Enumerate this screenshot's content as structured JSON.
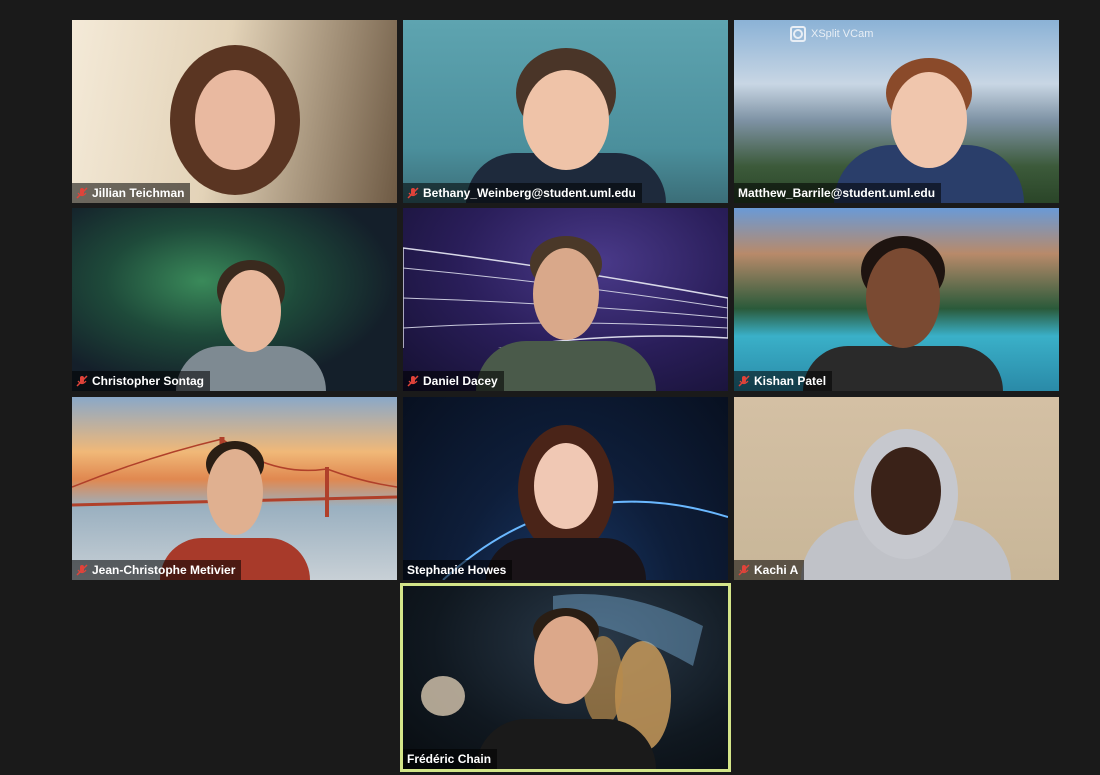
{
  "meeting": {
    "participants": [
      {
        "name": "Jillian Teichman",
        "muted": true
      },
      {
        "name": "Bethany_Weinberg@student.uml.edu",
        "muted": true
      },
      {
        "name": "Matthew_Barrile@student.uml.edu",
        "muted": false
      },
      {
        "name": "Christopher Sontag",
        "muted": true
      },
      {
        "name": "Daniel Dacey",
        "muted": true
      },
      {
        "name": "Kishan Patel",
        "muted": true
      },
      {
        "name": "Jean-Christophe Metivier",
        "muted": true
      },
      {
        "name": "Stephanie Howes",
        "muted": false
      },
      {
        "name": "Kachi A",
        "muted": true
      },
      {
        "name": "Frédéric Chain",
        "muted": false,
        "active_speaker": true
      }
    ],
    "vcam_badge": "XSplit VCam",
    "active_speaker_color": "#d4e589",
    "mute_icon_color": "#e0433a"
  }
}
